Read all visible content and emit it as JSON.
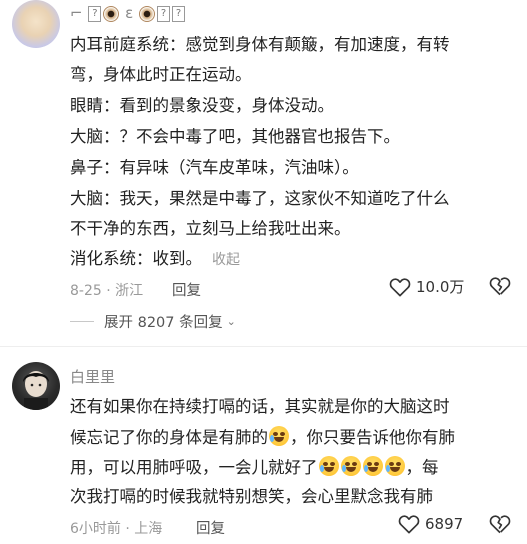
{
  "comment1": {
    "username_tail": "ε",
    "lines": [
      "内耳前庭系统：感觉到身体有颠簸，有加速度，有转",
      "弯，身体此时正在运动。",
      "眼睛：看到的景象没变，身体没动。",
      "大脑：？不会中毒了吧，其他器官也报告下。",
      "鼻子：有异味（汽车皮革味，汽油味）。",
      "大脑：我天，果然是中毒了，这家伙不知道吃了什么",
      "不干净的东西，立刻马上给我吐出来。",
      "消化系统：收到。"
    ],
    "collapse_label": "收起",
    "date_location": "8-25 · 浙江",
    "reply_label": "回复",
    "like_count": "10.0万"
  },
  "expand_label": "展开 8207 条回复",
  "comment2": {
    "username": "白里里",
    "line1": "还有如果你在持续打嗝的话，其实就是你的大脑这时",
    "line2a": "候忘记了你的身体是有肺的",
    "line2b": "，你只要告诉他你有肺",
    "line3a": "用，可以用肺呼吸，一会儿就好了",
    "line3b": "，每",
    "line4": "次我打嗝的时候我就特别想笑，会心里默念我有肺",
    "time_location": "6小时前 · 上海",
    "reply_label": "回复",
    "like_count": "6897"
  },
  "icons": {
    "like": "heart-outline-icon",
    "dislike": "broken-heart-icon",
    "emoji": "laughing-tears-emoji"
  }
}
